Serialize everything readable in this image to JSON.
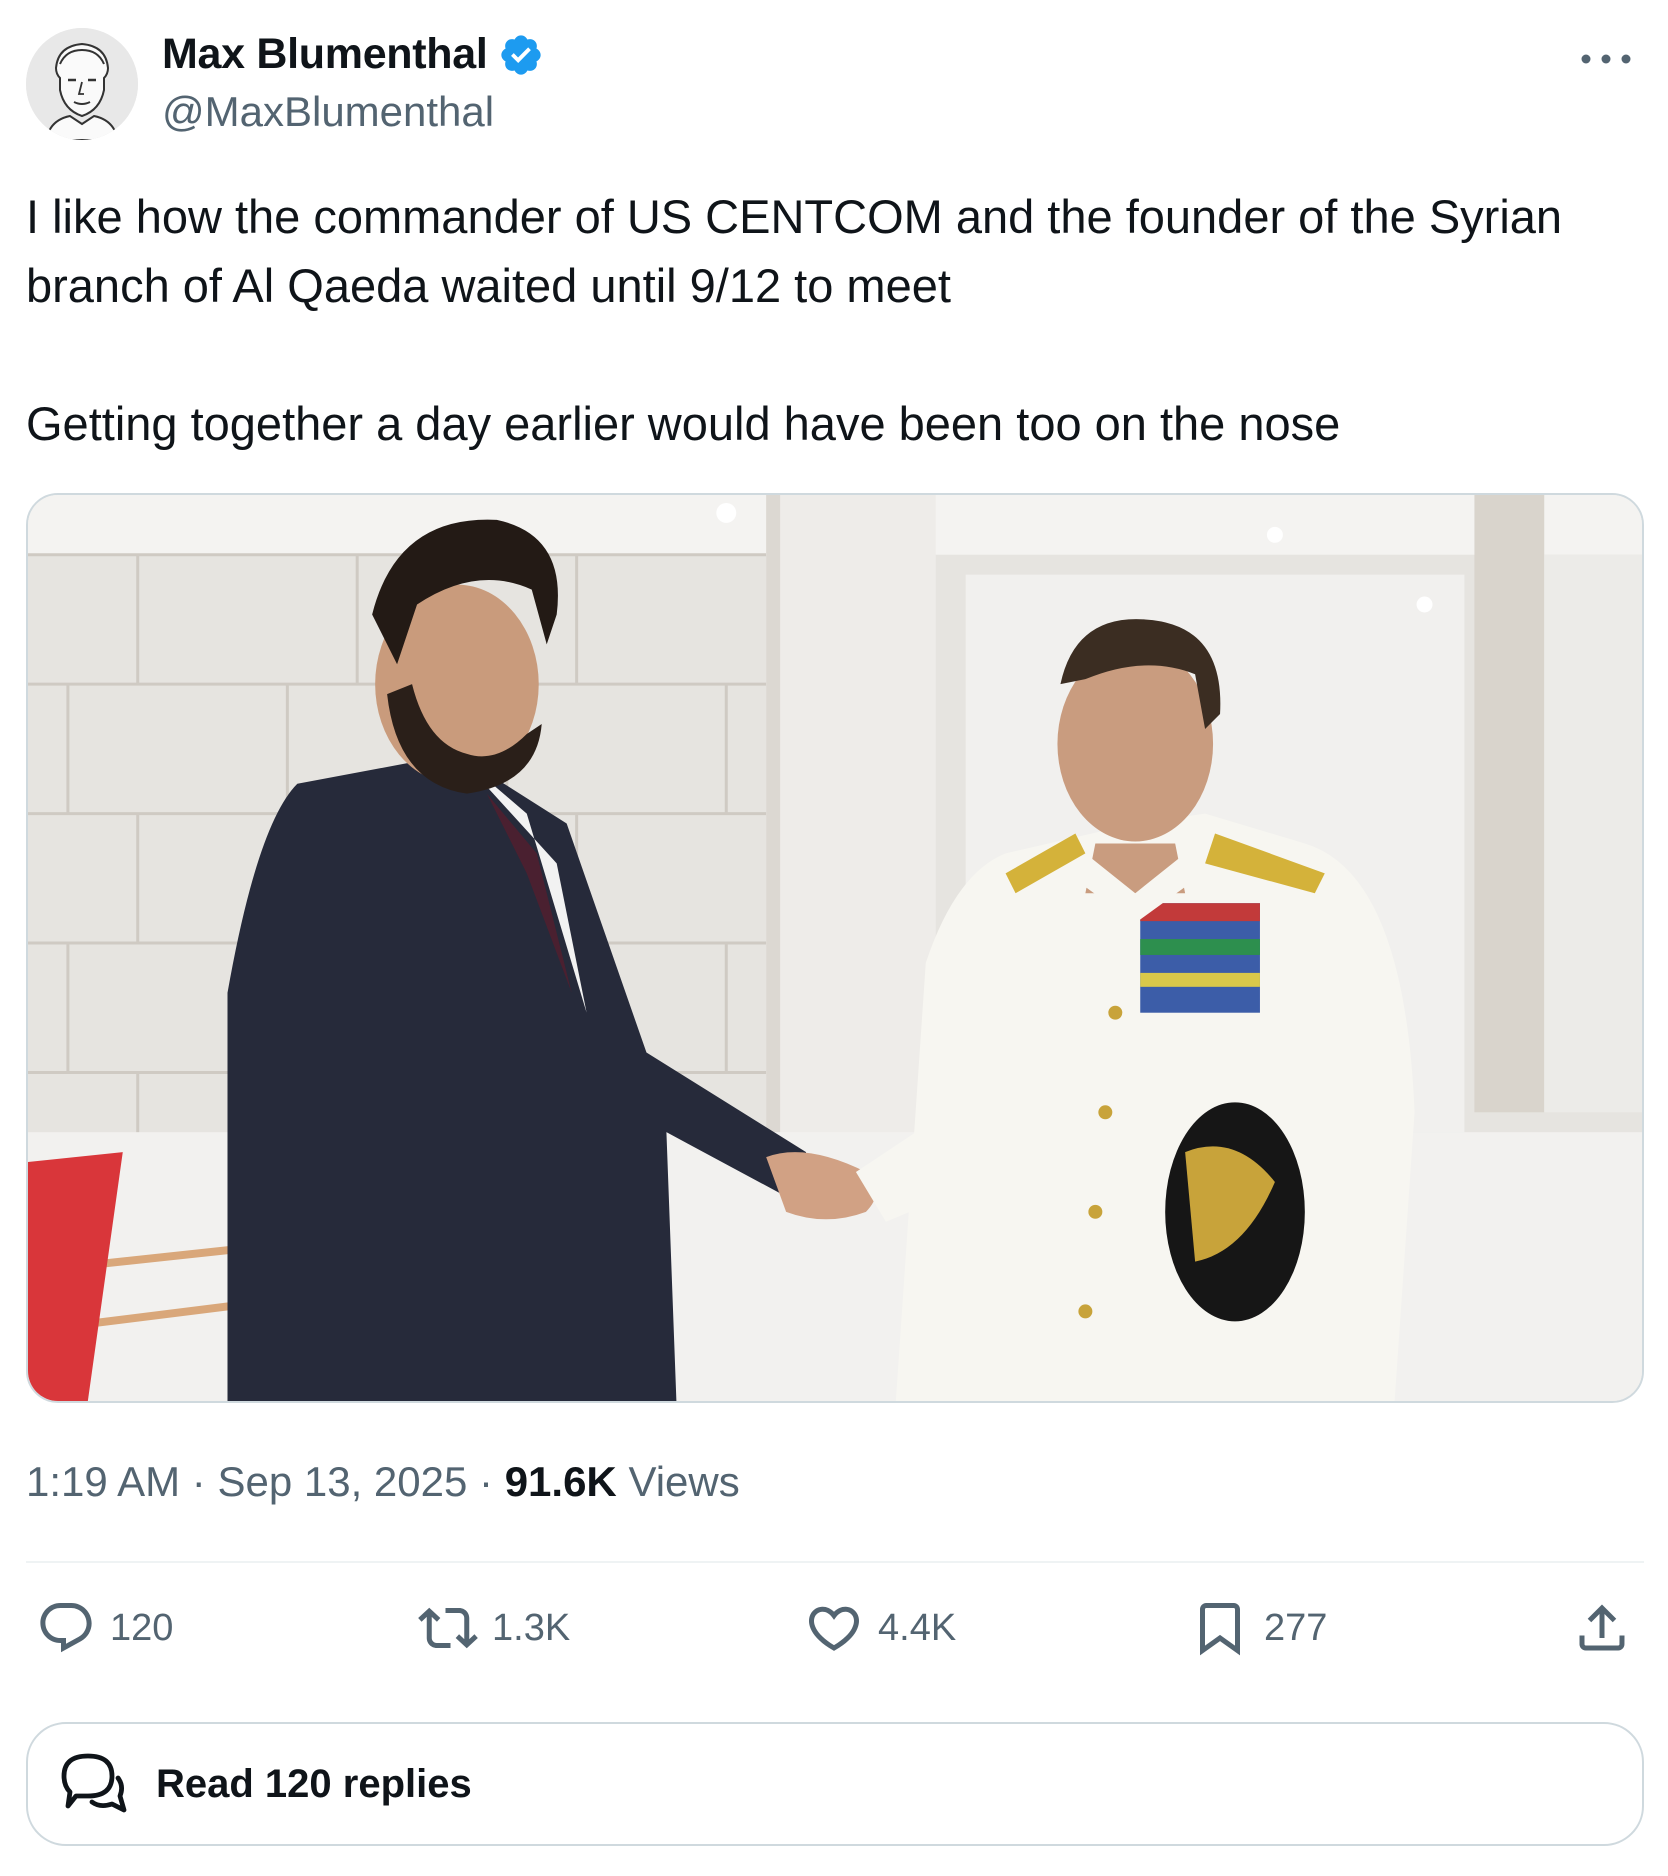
{
  "author": {
    "name": "Max Blumenthal",
    "handle": "@MaxBlumenthal",
    "verified": true,
    "verified_color": "#1d9bf0",
    "avatar_icon": "sketch-portrait-avatar"
  },
  "tweet": {
    "paragraphs": [
      "I like how the commander of US CENTCOM and the founder of the Syrian branch of Al Qaeda waited until 9/12 to meet",
      "Getting together a day earlier would have been too on the nose"
    ]
  },
  "media": {
    "type": "photo",
    "subject": "handshake-photo"
  },
  "meta": {
    "time": "1:19 AM",
    "separator": "·",
    "date": "Sep 13, 2025",
    "views_count": "91.6K",
    "views_label": "Views"
  },
  "actions": {
    "reply": {
      "icon": "reply-icon",
      "count": "120"
    },
    "repost": {
      "icon": "repost-icon",
      "count": "1.3K"
    },
    "like": {
      "icon": "heart-icon",
      "count": "4.4K"
    },
    "bookmark": {
      "icon": "bookmark-icon",
      "count": "277"
    },
    "share": {
      "icon": "share-icon"
    }
  },
  "read_replies": {
    "label": "Read 120 replies",
    "icon": "chat-bubbles-icon"
  },
  "colors": {
    "text_primary": "#0f1419",
    "text_secondary": "#536471",
    "border": "#cfd9de",
    "divider": "#eff3f4"
  }
}
